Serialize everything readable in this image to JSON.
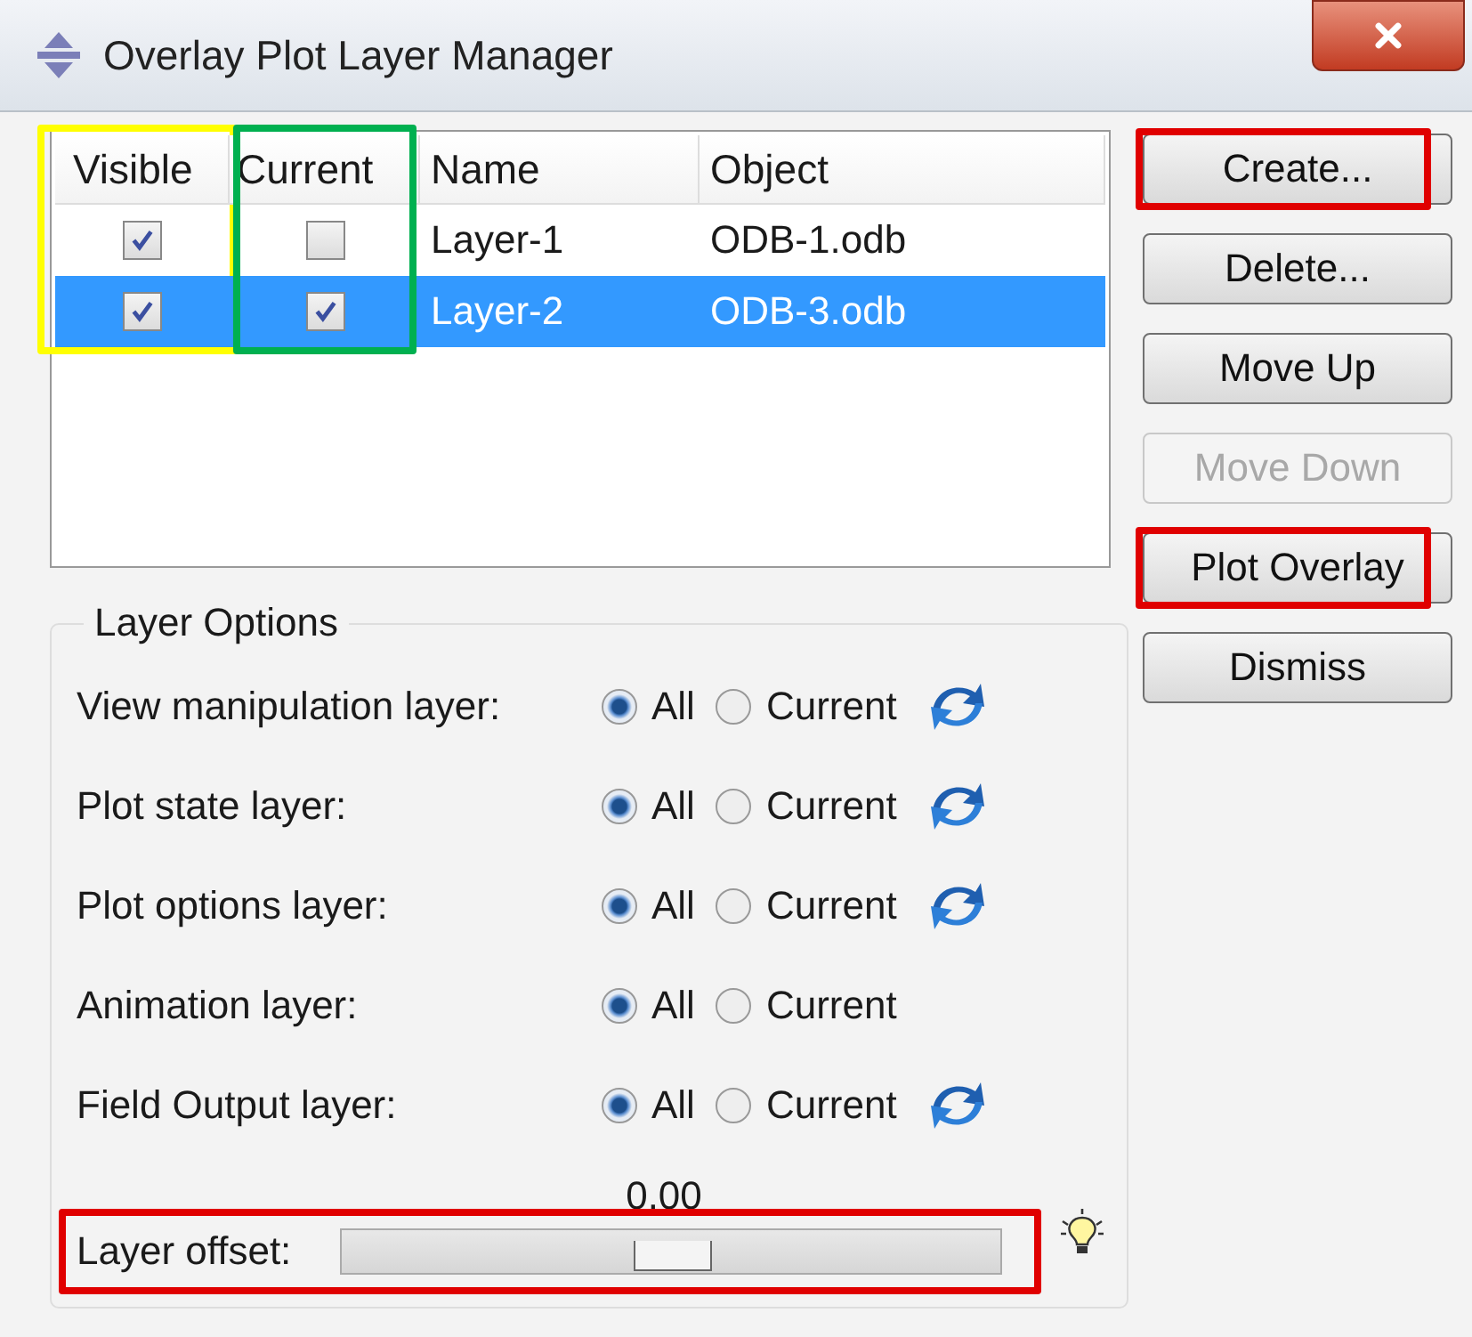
{
  "window": {
    "title": "Overlay Plot Layer Manager"
  },
  "table": {
    "columns": [
      {
        "label": "Visible",
        "kind": "checkbox",
        "color": "#ffff00"
      },
      {
        "label": "Current",
        "kind": "checkbox",
        "color": "#00b050"
      },
      {
        "label": "Name",
        "kind": "text"
      },
      {
        "label": "Object",
        "kind": "text"
      }
    ],
    "rows": [
      {
        "selected": false,
        "visible": true,
        "current": false,
        "name": "Layer-1",
        "object": "ODB-1.odb"
      },
      {
        "selected": true,
        "visible": true,
        "current": true,
        "name": "Layer-2",
        "object": "ODB-3.odb"
      }
    ]
  },
  "buttons": [
    {
      "label": "Create...",
      "disabled": false,
      "color": "#e00000"
    },
    {
      "label": "Delete...",
      "disabled": false
    },
    {
      "label": "Move Up",
      "disabled": false
    },
    {
      "label": "Move Down",
      "disabled": true
    },
    {
      "label": "Plot Overlay",
      "disabled": false,
      "color": "#e00000"
    },
    {
      "label": "Dismiss",
      "disabled": false
    }
  ],
  "layer_options": {
    "title": "Layer Options",
    "rows": [
      {
        "label": "View manipulation layer:",
        "sync": true,
        "options": [
          {
            "label": "All",
            "selected": true
          },
          {
            "label": "Current",
            "selected": false
          }
        ]
      },
      {
        "label": "Plot state layer:",
        "sync": true,
        "options": [
          {
            "label": "All",
            "selected": true
          },
          {
            "label": "Current",
            "selected": false
          }
        ]
      },
      {
        "label": "Plot options layer:",
        "sync": true,
        "options": [
          {
            "label": "All",
            "selected": true
          },
          {
            "label": "Current",
            "selected": false
          }
        ]
      },
      {
        "label": "Animation layer:",
        "sync": false,
        "options": [
          {
            "label": "All",
            "selected": true
          },
          {
            "label": "Current",
            "selected": false
          }
        ]
      },
      {
        "label": "Field Output layer:",
        "sync": true,
        "options": [
          {
            "label": "All",
            "selected": true
          },
          {
            "label": "Current",
            "selected": false
          }
        ]
      }
    ],
    "offset": {
      "label": "Layer offset:",
      "reading": "0.00",
      "level": 0.5,
      "color": "#e00000"
    }
  }
}
